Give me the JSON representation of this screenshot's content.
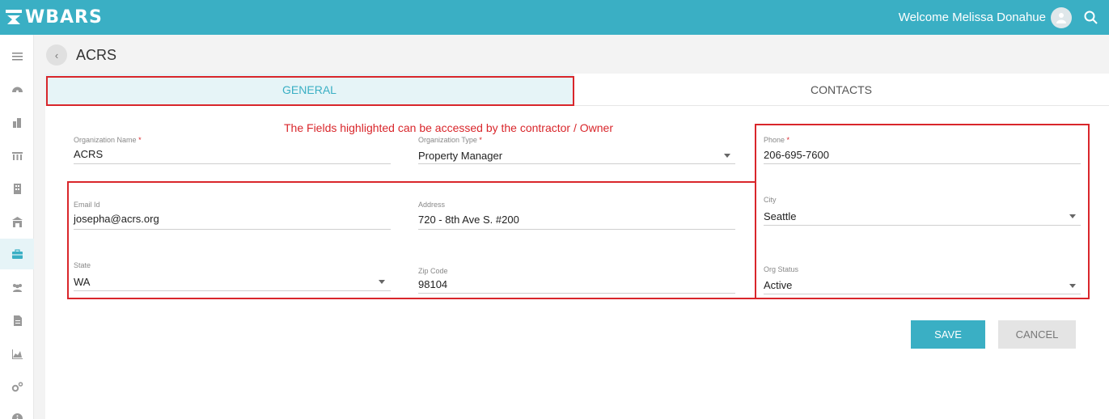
{
  "app": {
    "brand": "WBARS"
  },
  "header": {
    "welcome": "Welcome Melissa Donahue",
    "avatar_icon": "user-avatar-icon",
    "search_icon": "search-icon"
  },
  "sidebar": {
    "items": [
      {
        "icon": "menu-icon",
        "active": false
      },
      {
        "icon": "dashboard-icon",
        "active": false
      },
      {
        "icon": "buildings-icon",
        "active": false
      },
      {
        "icon": "columns-icon",
        "active": false
      },
      {
        "icon": "building-icon",
        "active": false
      },
      {
        "icon": "warehouse-icon",
        "active": false
      },
      {
        "icon": "briefcase-icon",
        "active": true
      },
      {
        "icon": "users-icon",
        "active": false
      },
      {
        "icon": "document-icon",
        "active": false
      },
      {
        "icon": "area-chart-icon",
        "active": false
      },
      {
        "icon": "settings-icon",
        "active": false
      },
      {
        "icon": "info-icon",
        "active": false
      }
    ]
  },
  "page": {
    "title": "ACRS"
  },
  "tabs": {
    "general": "GENERAL",
    "contacts": "CONTACTS"
  },
  "annotation": "The Fields highlighted can be accessed by the contractor / Owner",
  "form": {
    "org_name": {
      "label": "Organization Name",
      "value": "ACRS"
    },
    "org_type": {
      "label": "Organization Type",
      "value": "Property Manager"
    },
    "phone": {
      "label": "Phone",
      "value": "206-695-7600"
    },
    "email": {
      "label": "Email Id",
      "value": "josepha@acrs.org"
    },
    "address": {
      "label": "Address",
      "value": "720  - 8th Ave S. #200"
    },
    "city": {
      "label": "City",
      "value": "Seattle"
    },
    "state": {
      "label": "State",
      "value": "WA"
    },
    "zip": {
      "label": "Zip Code",
      "value": "98104"
    },
    "org_status": {
      "label": "Org Status",
      "value": "Active"
    },
    "required_mark": "*"
  },
  "buttons": {
    "save": "SAVE",
    "cancel": "CANCEL"
  },
  "colors": {
    "primary": "#3aafc4",
    "highlight": "#d9262b",
    "tab_active_bg": "#e6f4f7"
  }
}
